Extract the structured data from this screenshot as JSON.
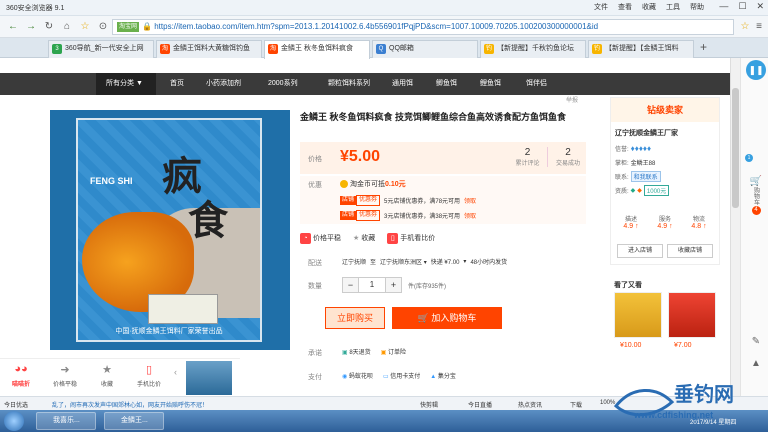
{
  "browser": {
    "title": "360安全浏览器 9.1",
    "menu": [
      "文件",
      "查看",
      "收藏",
      "工具",
      "帮助"
    ],
    "url_badge": "淘宝网",
    "url": "https://item.taobao.com/item.htm?spm=2013.1.20141002.6.4b556901fPqjPD&scm=1007.10009.70205.100200300000001&id",
    "tabs": [
      "360导航_新一代安全上网",
      "金鳞王饵料大黄糖饵钓鱼",
      "金鳞王 秋冬鱼饵料疯食",
      "QQ邮箱",
      "【新提醒】千秋钓鱼论坛",
      "【新提醒】【金鳞王饵料"
    ]
  },
  "nav": {
    "dropdown": "所有分类",
    "items": [
      "首页",
      "小药添加剂",
      "2000系列",
      "颗粒饵料系列",
      "通用饵",
      "鲫鱼饵",
      "鲤鱼饵",
      "饵伴侣"
    ]
  },
  "product": {
    "title": "金鳞王 秋冬鱼饵料疯食 技竞饵鲫鲤鱼综合鱼高效诱食配方鱼饵鱼食",
    "report": "举报",
    "price_label": "价格",
    "price": "¥5.00",
    "reviews_count": "2",
    "reviews_label": "累计评论",
    "trades_count": "2",
    "trades_label": "交易成功",
    "promo_label": "优惠",
    "coin_text": "淘金币可抵",
    "coin_amount": "0.10元",
    "coupon_tag1": "店铺",
    "coupon_tag2": "优惠券",
    "coupon1": "5元店铺优惠券，满78元可用",
    "coupon2": "3元店铺优惠券，满38元可用",
    "claim": "领取",
    "price_watch": "价格平稳",
    "favorite": "收藏",
    "compare": "手机看比价",
    "ship_label": "配送",
    "ship_from": "辽宁抚顺",
    "ship_to_prefix": "至",
    "ship_to": "辽宁抚顺东洲区",
    "ship_express": "快递 ¥7.00",
    "ship_time": "48小时内发货",
    "qty_label": "数量",
    "qty": "1",
    "stock": "件(库存935件)",
    "buy_now": "立即购买",
    "add_cart": "加入购物车",
    "promise_label": "承诺",
    "promise1": "8天退货",
    "promise2": "订单险",
    "pay_label": "支付",
    "pay1": "蚂蚁花呗",
    "pay2": "信用卡支付",
    "pay3": "集分宝",
    "pkg_text1": "疯",
    "pkg_text2": "食",
    "pkg_brand": "FENG SHI",
    "pkg_footer": "中国·抚顺金鳞王饵料厂家荣誉出品"
  },
  "seller": {
    "header": "钻级卖家",
    "shop": "辽宁抚顺金鳞王厂家",
    "rep_label": "信誉:",
    "owner_label": "掌柜:",
    "owner": "金鳞王88",
    "contact_label": "联系:",
    "contact": "和我联系",
    "qual_label": "资质:",
    "qual": "1000元",
    "dsr": [
      {
        "k": "描述",
        "v": "4.9 ↑"
      },
      {
        "k": "服务",
        "v": "4.9 ↑"
      },
      {
        "k": "物流",
        "v": "4.8 ↑"
      }
    ],
    "enter": "进入店铺",
    "fav_shop": "收藏店铺"
  },
  "also_viewed": {
    "title": "看了又看",
    "prices": [
      "¥10.00",
      "¥7.00"
    ]
  },
  "right_panel": {
    "cart_label": "购物车",
    "cart_count": "4",
    "msg_count": "1"
  },
  "floatbar": {
    "logo": "喵喵折",
    "items": [
      "价格平稳",
      "收藏",
      "手机比价"
    ]
  },
  "statusbar": {
    "left1": "今日优选",
    "left2": "乱了，闹市再次发声中国郊林心如，网友开始赔呼伤不冠！",
    "right": [
      "快剪辑",
      "今日直播",
      "热点资讯",
      "下载",
      "100%"
    ]
  },
  "taskbar": {
    "items": [
      "我喜乐...",
      "金鳞王..."
    ],
    "time": "2017/9/14 星期四"
  },
  "watermark": {
    "text": "垂钓网",
    "url": "www.cdfishing.net"
  }
}
